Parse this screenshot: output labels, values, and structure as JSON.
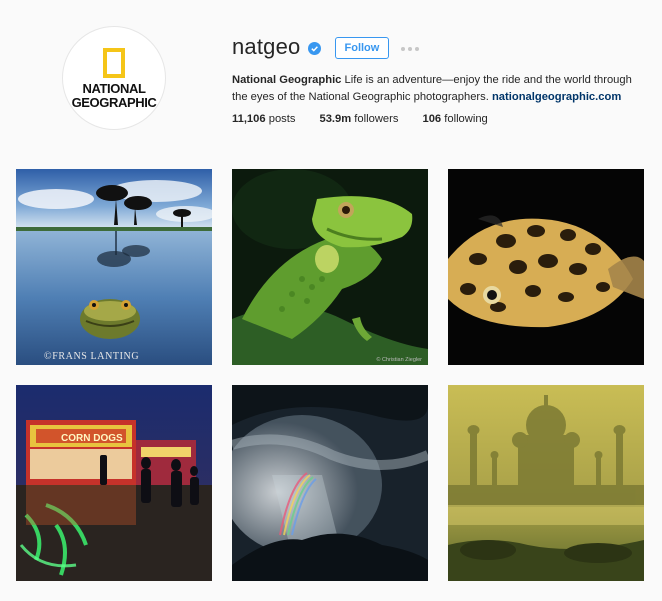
{
  "profile": {
    "avatar_text": "NATIONAL\nGEOGRAPHIC",
    "username": "natgeo",
    "verified_icon": "verified-check-icon",
    "follow_label": "Follow",
    "more_icon": "more-dots-icon",
    "bio": {
      "name": "National Geographic",
      "text": " Life is an adventure—enjoy the ride and the world through the eyes of the National Geographic photographers. ",
      "link": "nationalgeographic.com"
    },
    "stats": {
      "posts_count": "11,106",
      "posts_label": " posts",
      "followers_count": "53.9m",
      "followers_label": " followers",
      "following_count": "106",
      "following_label": " following"
    }
  },
  "posts": [
    {
      "subject": "frog in lake with acacia trees",
      "credit": "©FRANS LANTING"
    },
    {
      "subject": "green iguana",
      "credit": "© Christian Ziegler"
    },
    {
      "subject": "spotted pufferfish",
      "credit": ""
    },
    {
      "subject": "corn dogs stand at night fair",
      "credit": ""
    },
    {
      "subject": "storm cloud with rainbow",
      "credit": ""
    },
    {
      "subject": "taj mahal in morning fog",
      "credit": ""
    }
  ],
  "colors": {
    "accent": "#3897f0",
    "link": "#003569",
    "logo_yellow": "#f5c518"
  }
}
